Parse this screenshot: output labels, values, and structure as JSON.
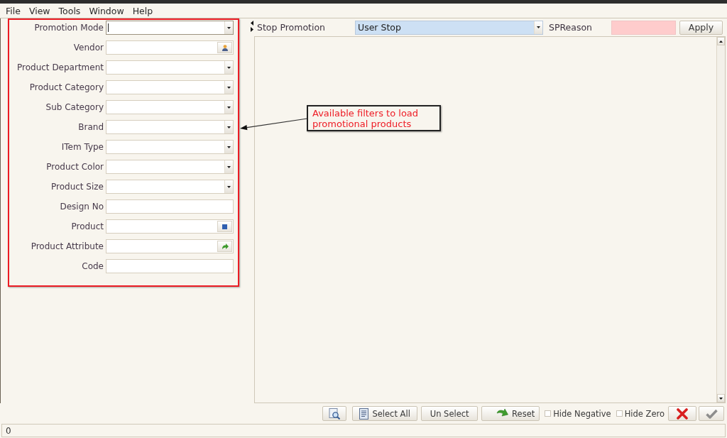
{
  "menu": [
    {
      "label": "File"
    },
    {
      "label": "View"
    },
    {
      "label": "Tools"
    },
    {
      "label": "Window"
    },
    {
      "label": "Help"
    }
  ],
  "filters": [
    {
      "label": "Promotion Mode",
      "kind": "combo",
      "focused": true
    },
    {
      "label": "Vendor",
      "kind": "party_lookup",
      "focused": false
    },
    {
      "label": "Product Department",
      "kind": "combo",
      "focused": false
    },
    {
      "label": "Product Category",
      "kind": "combo",
      "focused": false
    },
    {
      "label": "Sub Category",
      "kind": "combo",
      "focused": false
    },
    {
      "label": "Brand",
      "kind": "combo",
      "focused": false
    },
    {
      "label": "ITem Type",
      "kind": "combo",
      "focused": false
    },
    {
      "label": "Product Color",
      "kind": "combo",
      "focused": false
    },
    {
      "label": "Product Size",
      "kind": "combo",
      "focused": false
    },
    {
      "label": "Design No",
      "kind": "text",
      "focused": false
    },
    {
      "label": "Product",
      "kind": "item_lookup",
      "focused": false
    },
    {
      "label": "Product Attribute",
      "kind": "attribute_lookup",
      "focused": false
    },
    {
      "label": "Code",
      "kind": "text",
      "focused": false
    }
  ],
  "annotation": {
    "lines": [
      "Available filters to load",
      "promotional products"
    ]
  },
  "stop_bar": {
    "label": "Stop Promotion",
    "value": "User Stop",
    "highlighted": true,
    "reason_label": "SPReason",
    "reason_required": true,
    "apply": "Apply"
  },
  "toolbar": [
    {
      "kind": "preview"
    },
    {
      "kind": "select",
      "label": "Select All"
    },
    {
      "kind": "plain",
      "label": "Un Select"
    },
    {
      "kind": "reset",
      "label": "Reset"
    },
    {
      "kind": "checkbox",
      "label": "Hide Negative",
      "checked": false
    },
    {
      "kind": "checkbox",
      "label": "Hide Zero",
      "checked": false
    },
    {
      "kind": "cancel"
    },
    {
      "kind": "confirm"
    }
  ],
  "status_bar": {
    "text": "0"
  }
}
